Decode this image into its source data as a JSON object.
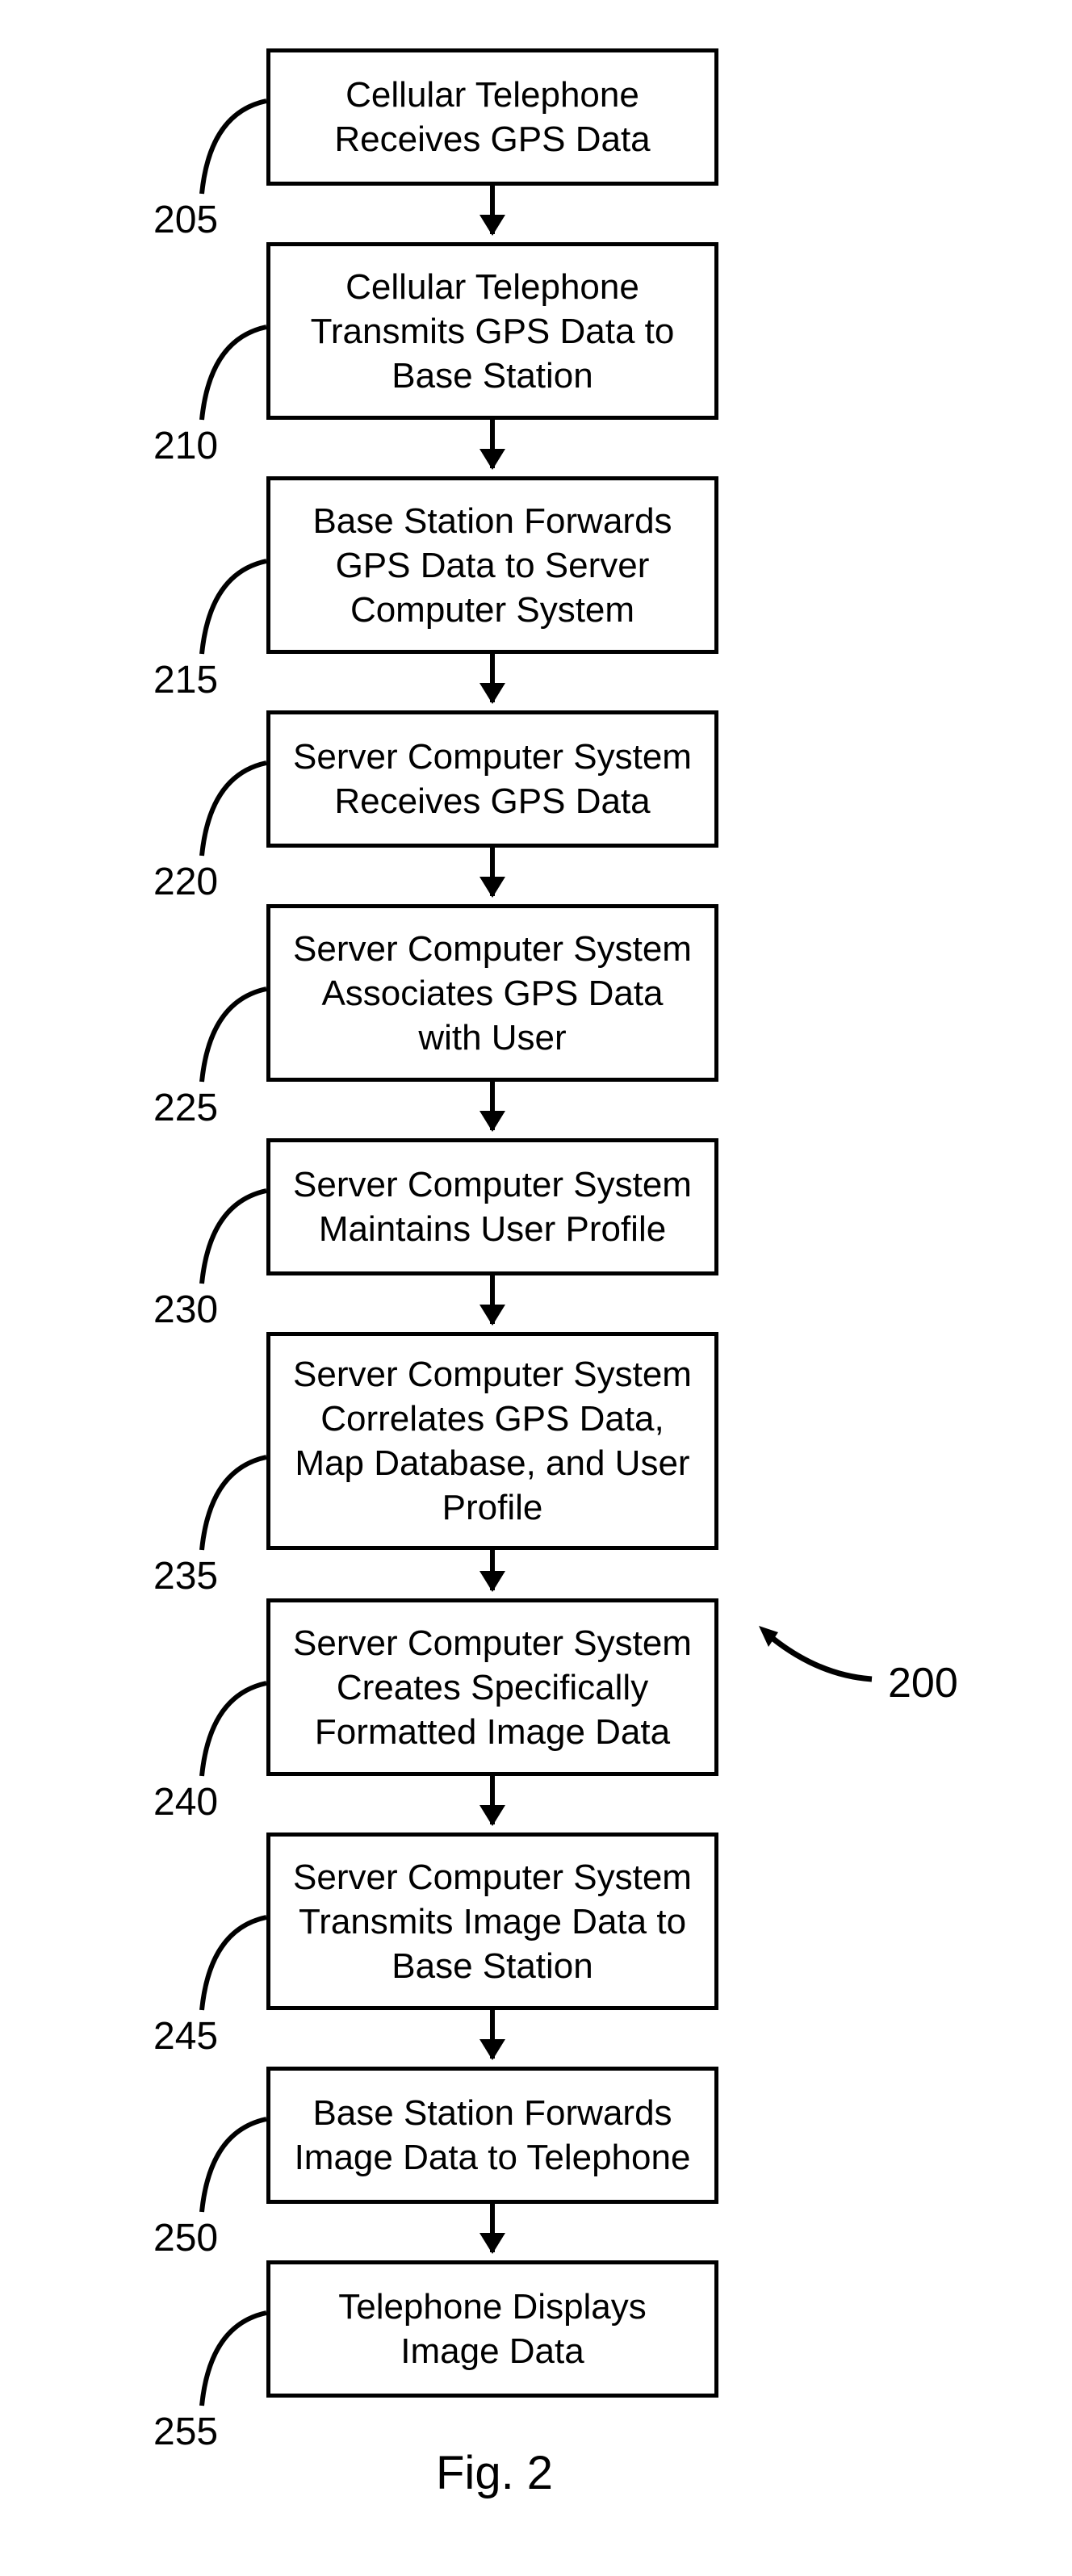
{
  "figure_label": "Fig. 2",
  "figure_ref": "200",
  "steps": [
    {
      "ref": "205",
      "text": "Cellular Telephone Receives GPS Data"
    },
    {
      "ref": "210",
      "text": "Cellular Telephone Transmits GPS Data to Base Station"
    },
    {
      "ref": "215",
      "text": "Base Station Forwards GPS Data to Server Computer System"
    },
    {
      "ref": "220",
      "text": "Server Computer System Receives GPS Data"
    },
    {
      "ref": "225",
      "text": "Server Computer System Associates GPS Data with User"
    },
    {
      "ref": "230",
      "text": "Server Computer System Maintains User Profile"
    },
    {
      "ref": "235",
      "text": "Server Computer System Correlates GPS Data, Map Database, and User Profile"
    },
    {
      "ref": "240",
      "text": "Server Computer System Creates Specifically Formatted Image Data"
    },
    {
      "ref": "245",
      "text": "Server Computer System Transmits Image Data to Base Station"
    },
    {
      "ref": "250",
      "text": "Base Station Forwards Image Data to Telephone"
    },
    {
      "ref": "255",
      "text": "Telephone Displays Image Data"
    }
  ],
  "chart_data": {
    "type": "table",
    "title": "Fig. 2 — Flowchart of GPS data path from cellular telephone through server to display",
    "columns": [
      "ref",
      "step_text"
    ],
    "rows": [
      [
        "205",
        "Cellular Telephone Receives GPS Data"
      ],
      [
        "210",
        "Cellular Telephone Transmits GPS Data to Base Station"
      ],
      [
        "215",
        "Base Station Forwards GPS Data to Server Computer System"
      ],
      [
        "220",
        "Server Computer System Receives GPS Data"
      ],
      [
        "225",
        "Server Computer System Associates GPS Data with User"
      ],
      [
        "230",
        "Server Computer System Maintains User Profile"
      ],
      [
        "235",
        "Server Computer System Correlates GPS Data, Map Database, and User Profile"
      ],
      [
        "240",
        "Server Computer System Creates Specifically Formatted Image Data"
      ],
      [
        "245",
        "Server Computer System Transmits Image Data to Base Station"
      ],
      [
        "250",
        "Base Station Forwards Image Data to Telephone"
      ],
      [
        "255",
        "Telephone Displays Image Data"
      ]
    ],
    "edges": [
      [
        "205",
        "210"
      ],
      [
        "210",
        "215"
      ],
      [
        "215",
        "220"
      ],
      [
        "220",
        "225"
      ],
      [
        "225",
        "230"
      ],
      [
        "230",
        "235"
      ],
      [
        "235",
        "240"
      ],
      [
        "240",
        "245"
      ],
      [
        "245",
        "250"
      ],
      [
        "250",
        "255"
      ]
    ],
    "overall_ref": "200"
  }
}
